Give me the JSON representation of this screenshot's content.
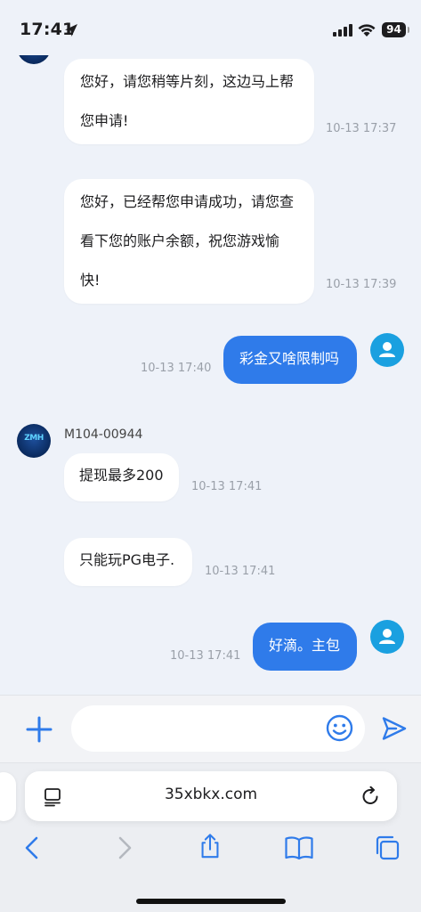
{
  "status_bar": {
    "time": "17:41",
    "battery": "94"
  },
  "messages": {
    "m1": {
      "text": "您好，请您稍等片刻，这边马上帮您申请!",
      "time": "10-13 17:37"
    },
    "m2": {
      "text": "您好，已经帮您申请成功，请您查看下您的账户余额，祝您游戏愉快!",
      "time": "10-13 17:39"
    },
    "m3": {
      "text": "彩金又啥限制吗",
      "time": "10-13 17:40"
    },
    "m4": {
      "sender": "M104-00944",
      "text": "提现最多200",
      "time": "10-13 17:41"
    },
    "m5": {
      "text": "只能玩PG电子.",
      "time": "10-13 17:41"
    },
    "m6": {
      "text": "好滴。主包",
      "time": "10-13 17:41"
    }
  },
  "composer": {
    "value": "",
    "placeholder": ""
  },
  "browser": {
    "url": "35xbkx.com"
  },
  "icons": {
    "plus": "plus-icon",
    "emoji": "smiley-icon",
    "send": "send-icon",
    "reader": "reader-icon",
    "reload": "reload-icon",
    "back": "back-chevron-icon",
    "forward": "forward-chevron-icon",
    "share": "share-icon",
    "bookmarks": "book-icon",
    "tabs": "tabs-icon"
  },
  "colors": {
    "accent": "#2f7bea",
    "background": "#eef2f9",
    "user_avatar": "#1aa0e0"
  }
}
